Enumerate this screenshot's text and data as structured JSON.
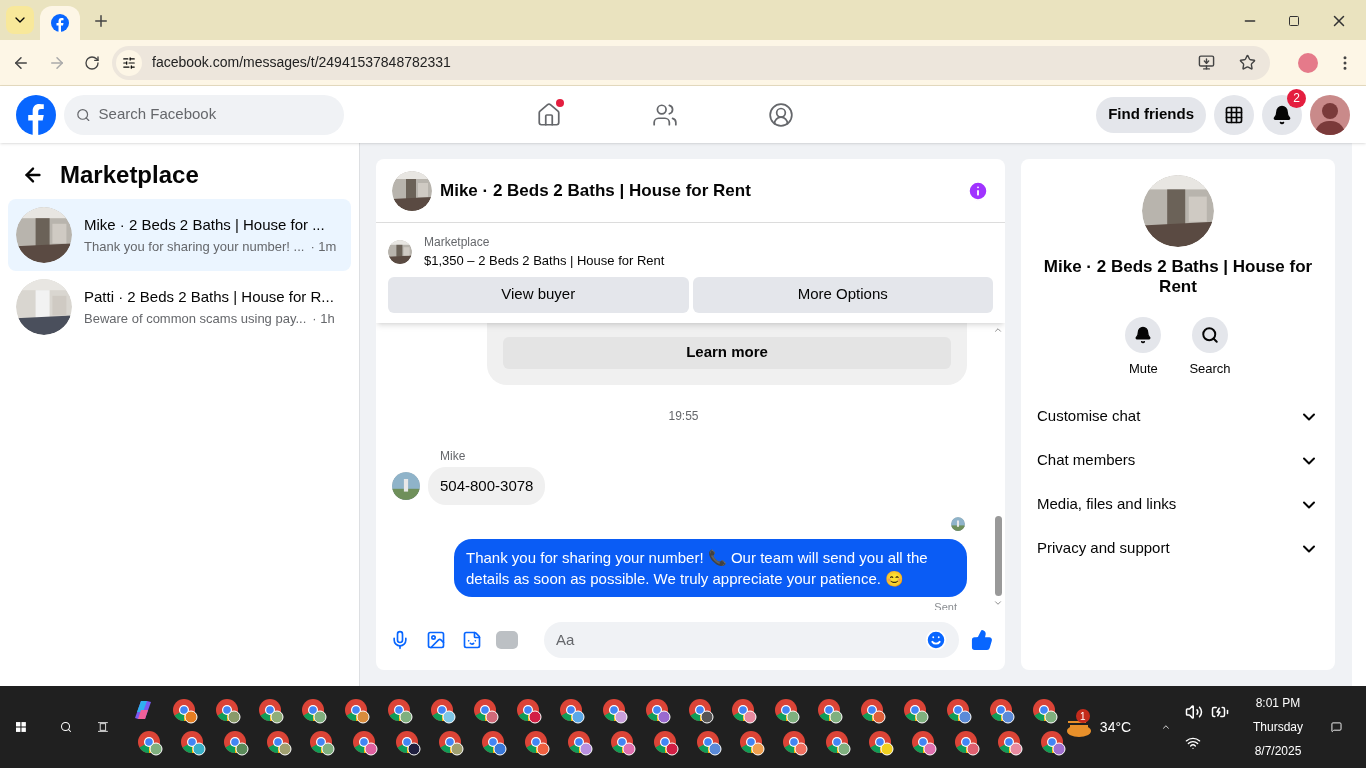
{
  "browser": {
    "url": "facebook.com/messages/t/24941537848782331"
  },
  "header": {
    "search_placeholder": "Search Facebook",
    "home_notification": true,
    "find_friends": "Find friends",
    "notification_count": "2"
  },
  "sidebar": {
    "title": "Marketplace",
    "conversations": [
      {
        "title": "Mike · 2 Beds 2 Baths | House for ...",
        "preview": "Thank you for sharing your number! ...",
        "time": "· 1m",
        "selected": true
      },
      {
        "title": "Patti · 2 Beds 2 Baths | House for R...",
        "preview": "Beware of common scams using pay...",
        "time": "· 1h",
        "selected": false
      }
    ]
  },
  "chat": {
    "title": "Mike · 2 Beds 2 Baths | House for Rent",
    "listing_label": "Marketplace",
    "listing_detail": "$1,350 – 2 Beds 2 Baths | House for Rent",
    "buttons": [
      "View buyer",
      "More Options"
    ],
    "learn_more": "Learn more",
    "timestamp": "19:55",
    "sender": "Mike",
    "incoming": "504-800-3078",
    "outgoing": "Thank you for sharing your number! 📞 Our team will send you all the details as soon as possible. We truly appreciate your patience. 😊",
    "status": "Sent",
    "composer_placeholder": "Aa"
  },
  "info": {
    "name": "Mike · 2 Beds 2 Baths | House for Rent",
    "actions": [
      {
        "kind": "mute",
        "label": "Mute"
      },
      {
        "kind": "search",
        "label": "Search"
      }
    ],
    "sections": [
      "Customise chat",
      "Chat members",
      "Media, files and links",
      "Privacy and support"
    ]
  },
  "taskbar": {
    "weather_badge": "1",
    "temperature": "34°C",
    "time": "8:01 PM",
    "day": "Thursday",
    "date": "8/7/2025"
  }
}
